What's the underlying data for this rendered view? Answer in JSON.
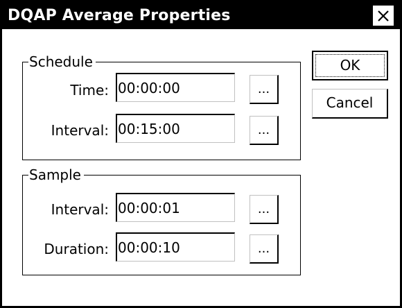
{
  "dialog": {
    "title": "DQAP Average Properties",
    "close_icon": "close-icon"
  },
  "schedule": {
    "legend": "Schedule",
    "time_label": "Time:",
    "time_value": "00:00:00",
    "interval_label": "Interval:",
    "interval_value": "00:15:00",
    "browse_label": "..."
  },
  "sample": {
    "legend": "Sample",
    "interval_label": "Interval:",
    "interval_value": "00:00:01",
    "duration_label": "Duration:",
    "duration_value": "00:00:10",
    "browse_label": "..."
  },
  "buttons": {
    "ok": "OK",
    "cancel": "Cancel"
  }
}
